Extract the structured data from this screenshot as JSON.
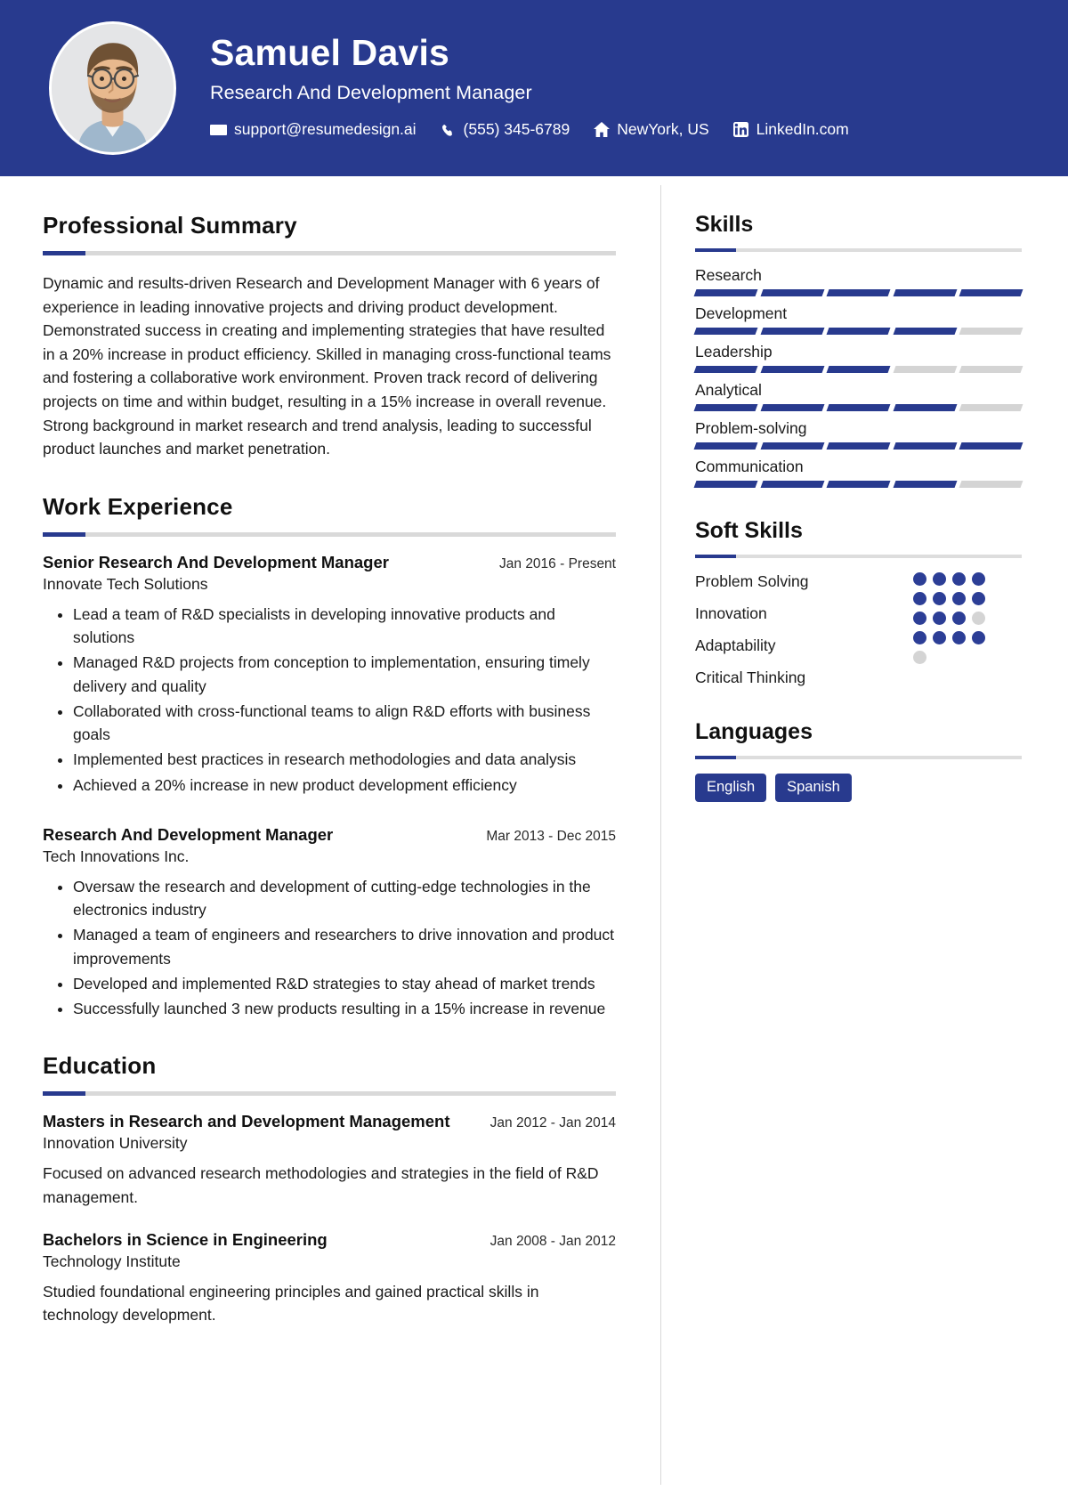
{
  "header": {
    "name": "Samuel Davis",
    "job_title": "Research And Development Manager",
    "avatar_alt": "profile-photo",
    "contacts": [
      {
        "icon": "envelope-icon",
        "text": "support@resumedesign.ai"
      },
      {
        "icon": "phone-icon",
        "text": "(555) 345-6789"
      },
      {
        "icon": "home-icon",
        "text": "NewYork, US"
      },
      {
        "icon": "linkedin-icon",
        "text": "LinkedIn.com"
      }
    ],
    "colors": {
      "background": "#283a8e",
      "text": "#ffffff"
    }
  },
  "summary": {
    "title": "Professional Summary",
    "text": "Dynamic and results-driven Research and Development Manager with 6 years of experience in leading innovative projects and driving product development. Demonstrated success in creating and implementing strategies that have resulted in a 20% increase in product efficiency. Skilled in managing cross-functional teams and fostering a collaborative work environment. Proven track record of delivering projects on time and within budget, resulting in a 15% increase in overall revenue. Strong background in market research and trend analysis, leading to successful product launches and market penetration."
  },
  "experience": {
    "title": "Work Experience",
    "entries": [
      {
        "role": "Senior Research And Development Manager",
        "dates": "Jan 2016 - Present",
        "organization": "Innovate Tech Solutions",
        "bullets": [
          "Lead a team of R&D specialists in developing innovative products and solutions",
          "Managed R&D projects from conception to implementation, ensuring timely delivery and quality",
          "Collaborated with cross-functional teams to align R&D efforts with business goals",
          "Implemented best practices in research methodologies and data analysis",
          "Achieved a 20% increase in new product development efficiency"
        ]
      },
      {
        "role": "Research And Development Manager",
        "dates": "Mar 2013 - Dec 2015",
        "organization": "Tech Innovations Inc.",
        "bullets": [
          "Oversaw the research and development of cutting-edge technologies in the electronics industry",
          "Managed a team of engineers and researchers to drive innovation and product improvements",
          "Developed and implemented R&D strategies to stay ahead of market trends",
          "Successfully launched 3 new products resulting in a 15% increase in revenue"
        ]
      }
    ]
  },
  "education": {
    "title": "Education",
    "entries": [
      {
        "degree": "Masters in Research and Development Management",
        "dates": "Jan 2012 - Jan 2014",
        "institution": "Innovation University",
        "description": "Focused on advanced research methodologies and strategies in the field of R&D management."
      },
      {
        "degree": "Bachelors in Science in Engineering",
        "dates": "Jan 2008 - Jan 2012",
        "institution": "Technology Institute",
        "description": "Studied foundational engineering principles and gained practical skills in technology development."
      }
    ]
  },
  "skills": {
    "title": "Skills",
    "max_level": 5,
    "items": [
      {
        "name": "Research",
        "level": 5
      },
      {
        "name": "Development",
        "level": 4
      },
      {
        "name": "Leadership",
        "level": 3
      },
      {
        "name": "Analytical",
        "level": 4
      },
      {
        "name": "Problem-solving",
        "level": 5
      },
      {
        "name": "Communication",
        "level": 4
      }
    ]
  },
  "soft_skills": {
    "title": "Soft Skills",
    "items": [
      {
        "name": "Problem Solving"
      },
      {
        "name": "Innovation"
      },
      {
        "name": "Adaptability"
      },
      {
        "name": "Critical Thinking"
      }
    ],
    "dots": [
      true,
      true,
      true,
      true,
      true,
      true,
      true,
      true,
      true,
      true,
      true,
      false,
      true,
      true,
      true,
      true,
      false
    ]
  },
  "languages": {
    "title": "Languages",
    "items": [
      "English",
      "Spanish"
    ]
  },
  "theme": {
    "accent": "#283a8e",
    "muted": "#d4d4d4",
    "text": "#1b1b1b"
  }
}
